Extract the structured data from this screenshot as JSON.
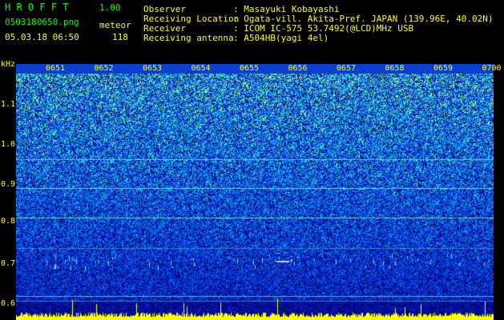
{
  "header": {
    "logo": "H R O F F T",
    "version": "1.00",
    "filename": "0503180650.png",
    "mode": "meteor",
    "datetime": "05.03.18 06:50",
    "count": "118"
  },
  "info": {
    "observer_label": "Observer",
    "observer_value": ": Masayuki Kobayashi",
    "location_label": "Receiving Location",
    "location_value": ": Ogata-vill. Akita-Pref. JAPAN (139.96E, 40.02N)",
    "receiver_label": "Receiver",
    "receiver_value": ": ICOM IC-575 53.7492(@LCD)MHz USB",
    "antenna_label": "Receiving antenna",
    "antenna_value": ": A504HB(yagi 4el)"
  },
  "axis": {
    "y_unit": "kHz",
    "y_ticks": [
      "1.1",
      "1.0",
      "0.9",
      "0.8",
      "0.7",
      "0.6"
    ],
    "x_ticks": [
      "0651",
      "0652",
      "0653",
      "0654",
      "0655",
      "0656",
      "0657",
      "0658",
      "0659",
      "0700"
    ]
  },
  "colors": {
    "background": "#000000",
    "label_yellow": "#ffff00",
    "label_green": "#00ff00",
    "timebar": "#0a3fd0"
  }
}
